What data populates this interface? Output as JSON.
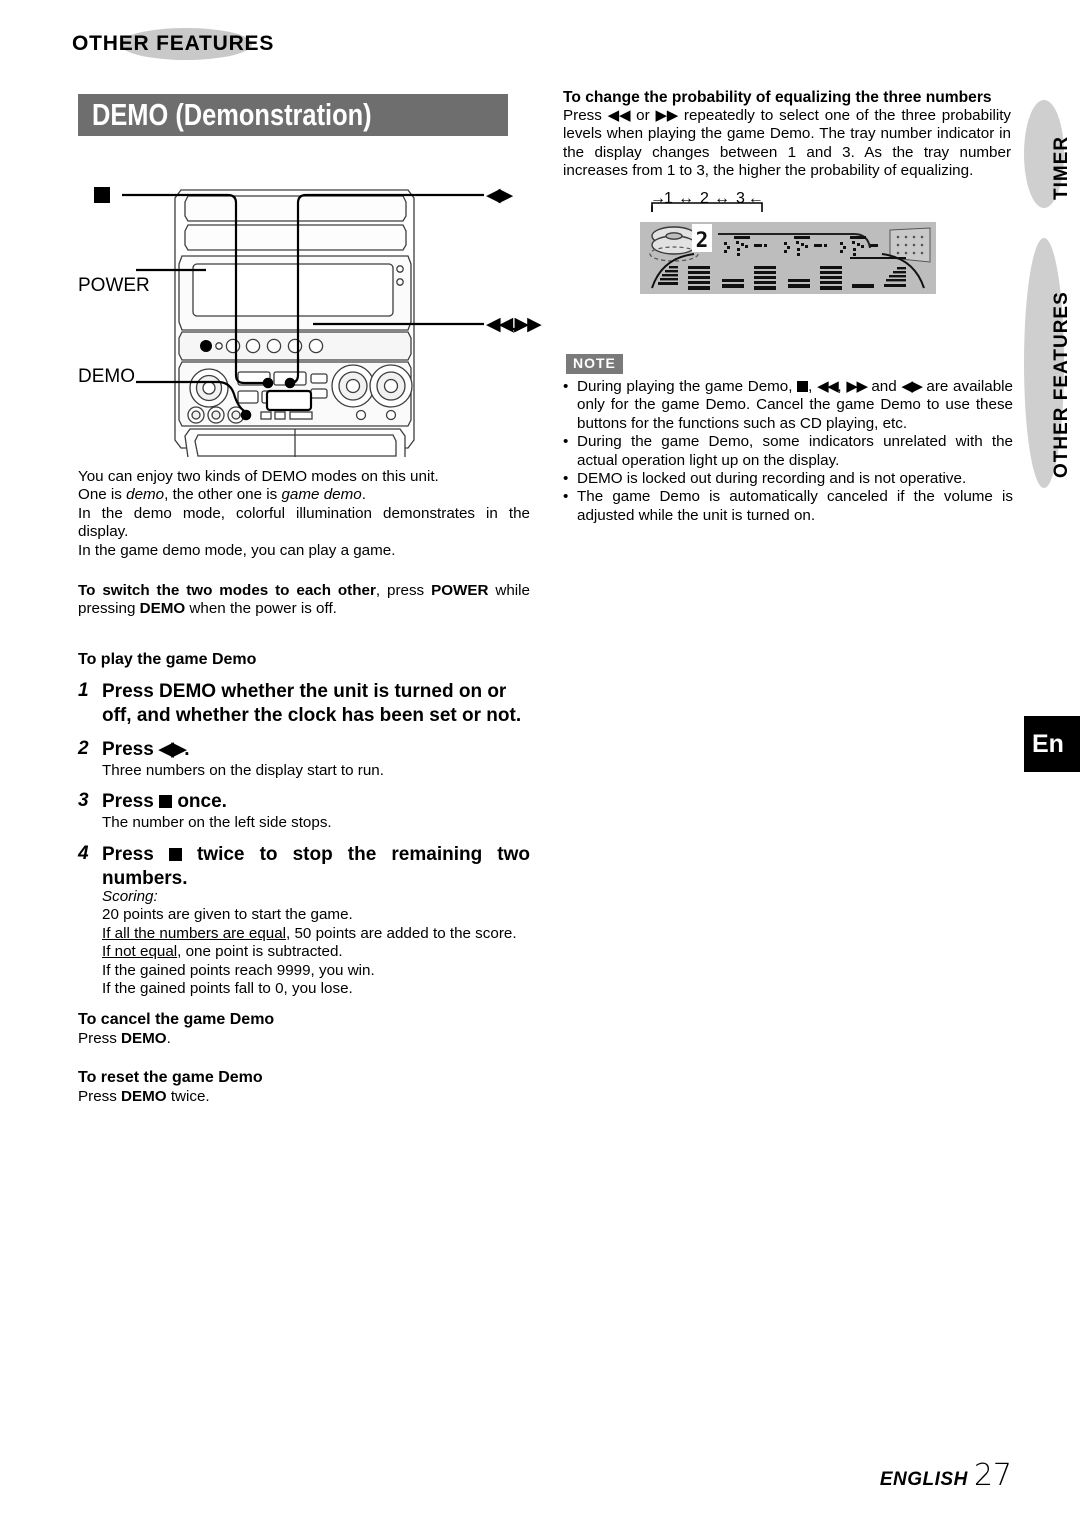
{
  "section": {
    "eyebrow": "OTHER FEATURES",
    "title": "DEMO (Demonstration)"
  },
  "figure_stereo": {
    "name": "stereo-system-front-panel",
    "labels_left": [
      {
        "id": "stop-button",
        "text": "■"
      },
      {
        "id": "power-button",
        "text": "POWER"
      },
      {
        "id": "demo-button",
        "text": "DEMO"
      }
    ],
    "labels_right": [
      {
        "id": "left-right-button",
        "text": "◀▶"
      },
      {
        "id": "skip-buttons",
        "text": "◀◀,▶▶"
      }
    ]
  },
  "intro": {
    "line1": "You can enjoy two kinds of DEMO modes on this unit.",
    "line2_a": "One is ",
    "line2_em1": "demo",
    "line2_b": ", the other one is ",
    "line2_em2": "game demo",
    "line2_c": ".",
    "line3": "In the demo mode, colorful illumination demonstrates in the display.",
    "line4": "In the game demo mode, you can play a game."
  },
  "switch_modes": {
    "bold_lead": "To switch the two modes to each other",
    "mid1": ", press ",
    "bold_power": "POWER",
    "mid2": " while pressing ",
    "bold_demo": "DEMO",
    "tail": " when the power is off."
  },
  "play_heading": "To play the game Demo",
  "steps": [
    {
      "num": "1",
      "title": "Press DEMO whether the unit is turned on or off, and whether the clock has been set or not.",
      "body": ""
    },
    {
      "num": "2",
      "title_pre": "Press ",
      "title_icon": "◀▶",
      "title_post": ".",
      "body": "Three numbers on the display start to run."
    },
    {
      "num": "3",
      "title_pre": "Press ",
      "title_icon": "square",
      "title_post": " once.",
      "body": "The number on the left side stops."
    },
    {
      "num": "4",
      "title_pre": "Press ",
      "title_icon": "square",
      "title_post": " twice to stop the remaining two numbers.",
      "body": ""
    }
  ],
  "scoring": {
    "label": "Scoring:",
    "lines": [
      {
        "plain": "20 points are given to start the game."
      },
      {
        "underline": "If all the numbers are equal",
        "rest": ", 50 points are added to the score."
      },
      {
        "underline": "If not equal",
        "rest": ", one point is subtracted."
      },
      {
        "plain": "If the gained points reach 9999, you win."
      },
      {
        "plain": "If the gained points fall to 0, you lose."
      }
    ]
  },
  "cancel": {
    "heading": "To cancel the game Demo",
    "body_pre": "Press ",
    "body_bold": "DEMO",
    "body_post": "."
  },
  "reset": {
    "heading": "To reset the game Demo",
    "body_pre": "Press ",
    "body_bold": "DEMO",
    "body_post": " twice."
  },
  "probability": {
    "heading": "To change the probability of equalizing the three numbers",
    "body_a": "Press ",
    "icon_rew": "◀◀",
    "body_b": " or ",
    "icon_ff": "▶▶",
    "body_c": " repeatedly to select one of the three probability levels when playing the game Demo. The tray number indicator in the display changes between 1 and 3. As the tray number increases from 1 to 3, the higher the probability of equalizing."
  },
  "figure_display": {
    "name": "display-panel-illustration",
    "tray_sequence": [
      "1",
      "2",
      "3"
    ],
    "arrow_glyph": "↔",
    "lead_arrow": "→",
    "tray_value_shown": "2"
  },
  "note": {
    "badge": "NOTE",
    "bullet": "•",
    "items": [
      {
        "pre": "During playing the game Demo, ",
        "icons": [
          "square",
          "◀◀",
          "▶▶",
          "◀▶"
        ],
        "post": " are available only for the game Demo. Cancel the game Demo to use these buttons for the functions such as CD playing, etc.",
        "text": "During playing the game Demo, ■, ◀◀, ▶▶ and ◀▶ are available only for the game Demo. Cancel the game Demo to use these buttons for the functions such as CD playing, etc."
      },
      {
        "text": "During the game Demo, some indicators unrelated with the actual operation light up on the display."
      },
      {
        "text": "DEMO is locked out during recording and is not operative."
      },
      {
        "text": "The game Demo is automatically canceled if the volume is adjusted while the unit is turned on."
      }
    ]
  },
  "side_tabs": [
    {
      "id": "timer",
      "label": "TIMER"
    },
    {
      "id": "other-features",
      "label": "OTHER FEATURES"
    }
  ],
  "language_box": {
    "label": "En"
  },
  "footer": {
    "language": "ENGLISH",
    "page": "27"
  },
  "colors": {
    "title_band": "#6e6e6e",
    "eyebrow_ellipse": "#c9c9c9",
    "note_badge": "#7a7a7a",
    "side_tab_ellipse": "#cfcfcf",
    "lcd_panel": "#bdbdbd",
    "text": "#000000"
  }
}
